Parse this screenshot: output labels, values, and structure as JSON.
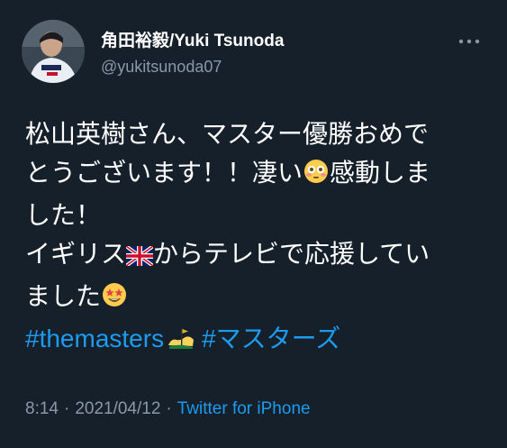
{
  "user": {
    "display_name": "角田裕毅/Yuki Tsunoda",
    "handle": "@yukitsunoda07"
  },
  "tweet": {
    "line1": "松山英樹さん、マスター優勝おめで",
    "line2a": "とうございます！！凄い",
    "line2b": "感動しま",
    "line3": "した！",
    "line4a": "イギリス",
    "line4b": "からテレビで応援してい",
    "line5a": "ました",
    "hashtag1": "#themasters",
    "hashtag2": "#マスターズ"
  },
  "icons": {
    "flushed_face": "flushed-face-emoji",
    "uk_flag": "uk-flag-emoji",
    "star_struck": "star-struck-emoji",
    "masters_logo": "masters-logo-emoji",
    "more": "more-options-icon"
  },
  "footer": {
    "time": "8:14",
    "separator": "·",
    "date": "2021/04/12",
    "source": "Twitter for iPhone"
  },
  "colors": {
    "background": "#15202b",
    "text": "#ffffff",
    "secondary": "#8b98a5",
    "link": "#1d9bf0"
  }
}
